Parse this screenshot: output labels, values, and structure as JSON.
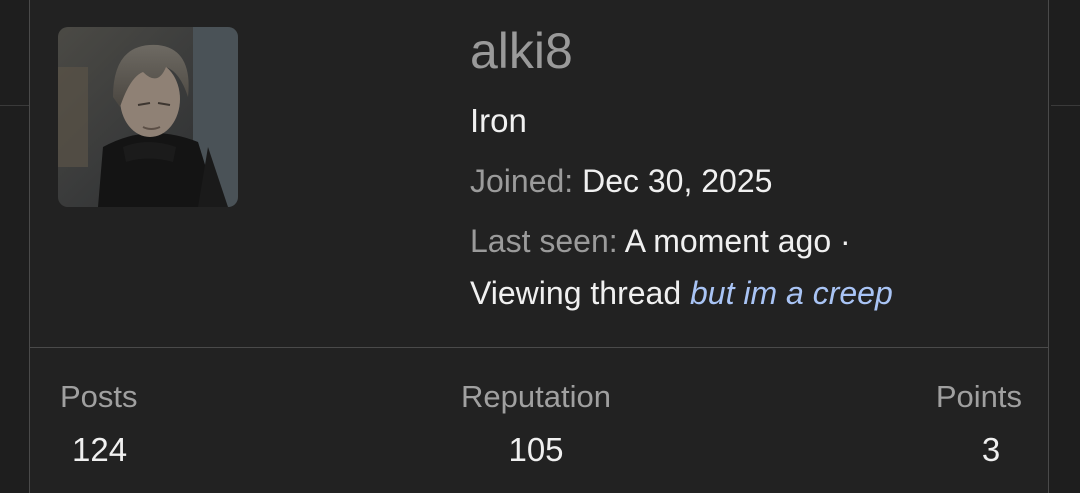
{
  "profile": {
    "username": "alki8",
    "rank": "Iron",
    "joined_label": "Joined:",
    "joined_value": "Dec 30, 2025",
    "last_seen_label": "Last seen:",
    "last_seen_value": "A moment ago ·",
    "activity_prefix": "Viewing thread",
    "activity_thread": "but im a creep"
  },
  "stats": {
    "posts_label": "Posts",
    "posts_value": "124",
    "reputation_label": "Reputation",
    "reputation_value": "105",
    "points_label": "Points",
    "points_value": "3"
  },
  "colors": {
    "background": "#1e1e1e",
    "card": "#222222",
    "border": "#4a4a4a",
    "link": "#a9c4f5"
  }
}
